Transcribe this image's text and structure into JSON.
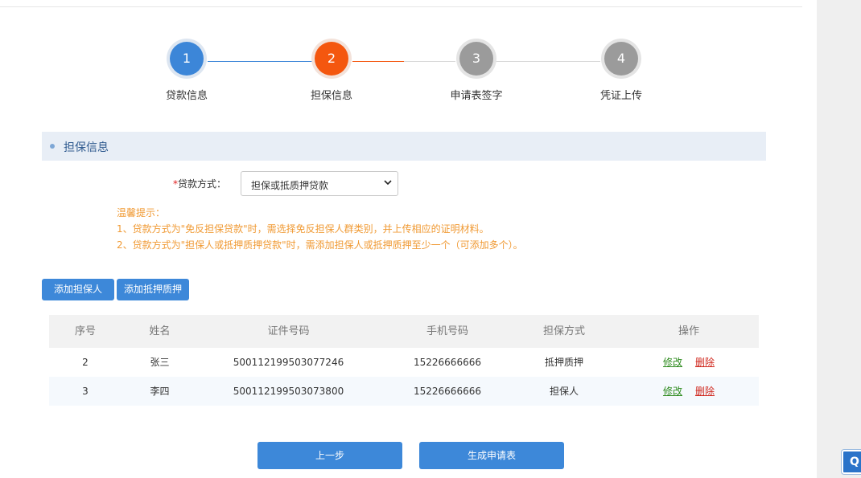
{
  "steps": [
    {
      "number": "1",
      "label": "贷款信息",
      "state": "done"
    },
    {
      "number": "2",
      "label": "担保信息",
      "state": "active"
    },
    {
      "number": "3",
      "label": "申请表签字",
      "state": "todo"
    },
    {
      "number": "4",
      "label": "凭证上传",
      "state": "todo"
    }
  ],
  "section": {
    "title": "担保信息"
  },
  "form": {
    "required_mark": "*",
    "loan_method_label": "贷款方式：",
    "loan_method_value": "担保或抵质押贷款"
  },
  "tips": {
    "title": "温馨提示：",
    "line1": "1、贷款方式为\"免反担保贷款\"时，需选择免反担保人群类别，并上传相应的证明材料。",
    "line2": "2、贷款方式为\"担保人或抵押质押贷款\"时，需添加担保人或抵押质押至少一个（可添加多个）。"
  },
  "buttons": {
    "add_guarantor": "添加担保人",
    "add_collateral": "添加抵押质押",
    "prev": "上一步",
    "generate": "生成申请表"
  },
  "table": {
    "headers": [
      "序号",
      "姓名",
      "证件号码",
      "手机号码",
      "担保方式",
      "操作"
    ],
    "rows": [
      {
        "no": "2",
        "name": "张三",
        "id_number": "500112199503077246",
        "phone": "15226666666",
        "method": "抵押质押",
        "edit": "修改",
        "delete": "删除"
      },
      {
        "no": "3",
        "name": "李四",
        "id_number": "500112199503073800",
        "phone": "15226666666",
        "method": "担保人",
        "edit": "修改",
        "delete": "删除"
      }
    ]
  },
  "corner_widget": {
    "label": "Q"
  },
  "colors": {
    "primary": "#3d88d9",
    "active_step": "#f4570f",
    "todo_step": "#9b9b9b",
    "tip": "#f09a34",
    "edit_link": "#2e8b1e",
    "delete_link": "#d0281e"
  }
}
